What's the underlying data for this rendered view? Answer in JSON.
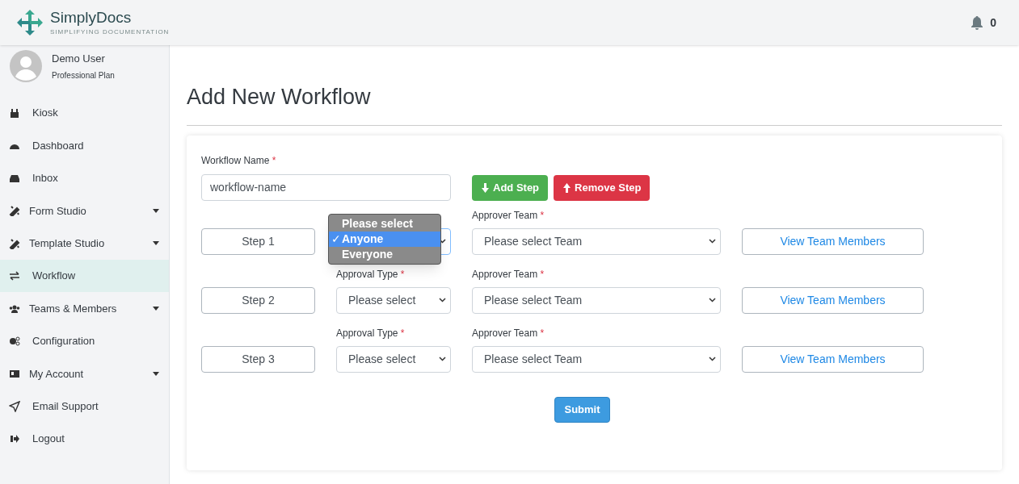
{
  "header": {
    "brand": "SimplyDocs",
    "tagline": "SIMPLIFYING DOCUMENTATION",
    "notifications": "0"
  },
  "user": {
    "name": "Demo User",
    "plan": "Professional Plan"
  },
  "sidebar": {
    "items": [
      {
        "label": "Kiosk",
        "expandable": false,
        "selected": false
      },
      {
        "label": "Dashboard",
        "expandable": false,
        "selected": false
      },
      {
        "label": "Inbox",
        "expandable": false,
        "selected": false
      },
      {
        "label": "Form Studio",
        "expandable": true,
        "selected": false
      },
      {
        "label": "Template Studio",
        "expandable": true,
        "selected": false
      },
      {
        "label": "Workflow",
        "expandable": false,
        "selected": true
      },
      {
        "label": "Teams & Members",
        "expandable": true,
        "selected": false
      },
      {
        "label": "Configuration",
        "expandable": false,
        "selected": false
      },
      {
        "label": "My Account",
        "expandable": true,
        "selected": false
      },
      {
        "label": "Email Support",
        "expandable": false,
        "selected": false
      },
      {
        "label": "Logout",
        "expandable": false,
        "selected": false
      }
    ]
  },
  "page": {
    "title": "Add New Workflow"
  },
  "form": {
    "name_label": "Workflow Name",
    "required_mark": "*",
    "name_value": "workflow-name",
    "add_button": "Add Step",
    "remove_button": "Remove Step",
    "steps": [
      {
        "label": "Step 1",
        "team_label": "Approver Team",
        "team_value": "Please select Team",
        "view_button": "View Team Members",
        "dropdown_open": true
      },
      {
        "label": "Step 2",
        "approval_label": "Approval Type",
        "approval_value": "Please select",
        "team_label": "Approver Team",
        "team_value": "Please select Team",
        "view_button": "View Team Members",
        "dropdown_open": false
      },
      {
        "label": "Step 3",
        "approval_label": "Approval Type",
        "approval_value": "Please select",
        "team_label": "Approver Team",
        "team_value": "Please select Team",
        "view_button": "View Team Members",
        "dropdown_open": false
      }
    ],
    "dropdown": {
      "check": "✓",
      "options": [
        {
          "label": "Please select",
          "selected": false
        },
        {
          "label": "Anyone",
          "selected": true
        },
        {
          "label": "Everyone",
          "selected": false
        }
      ]
    },
    "submit": "Submit"
  }
}
